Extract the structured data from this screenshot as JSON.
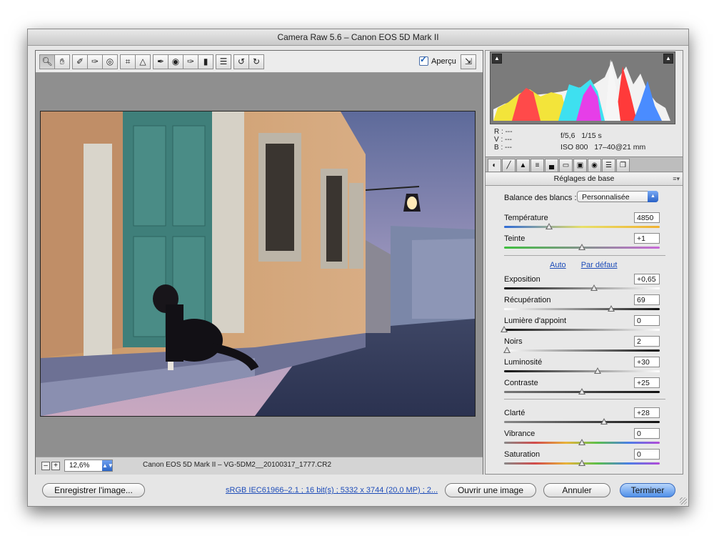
{
  "window": {
    "title": "Camera Raw 5.6  –  Canon EOS 5D Mark II"
  },
  "toolbar": {
    "tools": [
      "zoom-tool",
      "hand-tool",
      "white-balance-tool",
      "color-sampler-tool",
      "target-adjustment-tool",
      "crop-tool",
      "straighten-tool",
      "spot-removal-tool",
      "red-eye-tool",
      "adjustment-brush",
      "graduated-filter",
      "preferences",
      "rotate-ccw",
      "rotate-cw"
    ],
    "preview_label": "Aperçu",
    "preview_checked": true
  },
  "bottombar": {
    "zoom_out": "–",
    "zoom_in": "+",
    "zoom_value": "12,6%",
    "filename": "Canon EOS 5D Mark II  –  VG-5DM2__20100317_1777.CR2"
  },
  "histogram": {
    "rgb": {
      "r_label": "R :",
      "r_value": "---",
      "v_label": "V :",
      "v_value": "---",
      "b_label": "B :",
      "b_value": "---"
    },
    "exif": {
      "aperture": "f/5,6",
      "shutter": "1/15 s",
      "iso": "ISO 800",
      "lens": "17–40@21 mm"
    }
  },
  "panel": {
    "title": "Réglages de base",
    "wb_label": "Balance des blancs :",
    "wb_value": "Personnalisée",
    "auto_link": "Auto",
    "default_link": "Par défaut",
    "sliders": [
      {
        "label": "Température",
        "value": "4850",
        "level": 0.29
      },
      {
        "label": "Teinte",
        "value": "+1",
        "level": 0.5
      },
      {
        "label": "Exposition",
        "value": "+0,65",
        "level": 0.58
      },
      {
        "label": "Récupération",
        "value": "69",
        "level": 0.69
      },
      {
        "label": "Lumière d'appoint",
        "value": "0",
        "level": 0.0
      },
      {
        "label": "Noirs",
        "value": "2",
        "level": 0.02
      },
      {
        "label": "Luminosité",
        "value": "+30",
        "level": 0.6
      },
      {
        "label": "Contraste",
        "value": "+25",
        "level": 0.5
      },
      {
        "label": "Clarté",
        "value": "+28",
        "level": 0.64
      },
      {
        "label": "Vibrance",
        "value": "0",
        "level": 0.5
      },
      {
        "label": "Saturation",
        "value": "0",
        "level": 0.5
      }
    ]
  },
  "footer": {
    "save_label": "Enregistrer l'image...",
    "workflow_link": "sRGB IEC61966–2.1 ; 16 bit(s) ; 5332 x 3744 (20,0 MP) ; 2...",
    "open_label": "Ouvrir une image",
    "cancel_label": "Annuler",
    "done_label": "Terminer"
  }
}
